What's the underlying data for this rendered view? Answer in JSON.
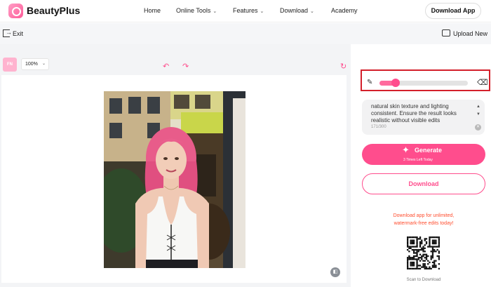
{
  "nav": {
    "brand": "BeautyPlus",
    "items": [
      {
        "label": "Home",
        "dropdown": false
      },
      {
        "label": "Online Tools",
        "dropdown": true
      },
      {
        "label": "Features",
        "dropdown": true
      },
      {
        "label": "Download",
        "dropdown": true
      },
      {
        "label": "Academy",
        "dropdown": false
      }
    ],
    "download_app": "Download App"
  },
  "toolbar": {
    "exit": "Exit",
    "upload_new": "Upload New"
  },
  "editor": {
    "badge": "FN",
    "zoom": "100%",
    "undo_icon": "undo-icon",
    "redo_icon": "redo-icon",
    "reset_icon": "reset-icon"
  },
  "brush": {
    "brush_icon": "brush-icon",
    "eraser_icon": "eraser-icon",
    "size_level": 0.18
  },
  "prompt": {
    "text": "natural skin texture and lighting consistent. Ensure the result looks realistic without visible edits",
    "count": "171/300"
  },
  "generate": {
    "label": "Generate",
    "sub": "3 Times Left Today"
  },
  "download": {
    "label": "Download"
  },
  "promo": {
    "line1": "Download app for unlimited,",
    "line2": "watermark-free edits today!",
    "scan": "Scan to Download"
  },
  "colors": {
    "accent": "#ff4d8d",
    "highlight": "#d4202b",
    "promo": "#ff4d2e"
  }
}
